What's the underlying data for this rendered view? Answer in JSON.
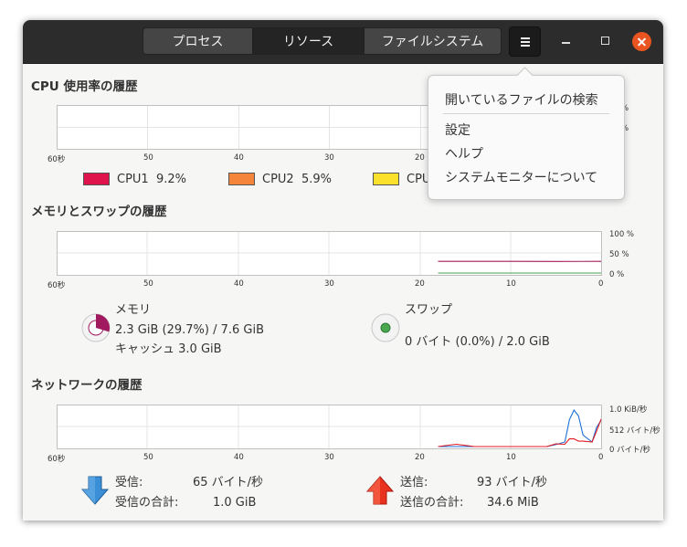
{
  "header": {
    "tabs": [
      {
        "label": "プロセス",
        "active": false
      },
      {
        "label": "リソース",
        "active": true
      },
      {
        "label": "ファイルシステム",
        "active": false
      }
    ],
    "menu_icon": "hamburger-icon",
    "minimize_glyph": "−",
    "maximize_glyph": "□",
    "close_icon": "close-icon"
  },
  "cpu": {
    "title": "CPU 使用率の履歴",
    "x_ticks": [
      "60秒",
      "50",
      "40",
      "30",
      "20"
    ],
    "y_ticks": [
      "%",
      "%"
    ],
    "legend": [
      {
        "name": "CPU1",
        "value": "9.2%",
        "color": "#e0144d"
      },
      {
        "name": "CPU2",
        "value": "5.9%",
        "color": "#f5853a"
      },
      {
        "name": "CPU",
        "value": "",
        "color": "#fbe12b"
      }
    ]
  },
  "memory": {
    "title": "メモリとスワップの履歴",
    "x_ticks": [
      "60秒",
      "50",
      "40",
      "30",
      "20",
      "10",
      "0"
    ],
    "y_ticks": [
      "100 %",
      "50 %",
      "0 %"
    ],
    "memory_label": "メモリ",
    "memory_value": "2.3 GiB (29.7%) / 7.6 GiB",
    "cache_value": "キャッシュ 3.0 GiB",
    "swap_label": "スワップ",
    "swap_value": "0 バイト (0.0%) / 2.0 GiB",
    "memory_color": "#a11a60",
    "swap_color": "#4aa64f",
    "memory_percent": 29.7,
    "swap_percent": 0.0
  },
  "network": {
    "title": "ネットワークの履歴",
    "x_ticks": [
      "60秒",
      "50",
      "40",
      "30",
      "20",
      "10",
      "0"
    ],
    "y_ticks": [
      "1.0 KiB/秒",
      "512 バイト/秒",
      "0 バイト/秒"
    ],
    "recv_label": "受信:",
    "recv_value": "65 バイト/秒",
    "recv_total_label": "受信の合計:",
    "recv_total_value": "1.0 GiB",
    "send_label": "送信:",
    "send_value": "93 バイト/秒",
    "send_total_label": "送信の合計:",
    "send_total_value": "34.6 MiB",
    "recv_color": "#1c71d8",
    "send_color": "#e01b24"
  },
  "chart_data": [
    {
      "type": "line",
      "title": "メモリとスワップの履歴",
      "x": [
        18,
        15,
        10,
        5,
        0
      ],
      "series": [
        {
          "name": "メモリ",
          "values": [
            29.7,
            29.8,
            29.7,
            29.6,
            29.7
          ]
        },
        {
          "name": "スワップ",
          "values": [
            0,
            0,
            0,
            0,
            0
          ]
        }
      ],
      "xlim": [
        60,
        0
      ],
      "ylim": [
        0,
        100
      ]
    },
    {
      "type": "line",
      "title": "ネットワークの履歴",
      "x": [
        18,
        16,
        14,
        12,
        10,
        8,
        6,
        5,
        4,
        3.5,
        3,
        2.5,
        2,
        1,
        0.5,
        0
      ],
      "series": [
        {
          "name": "受信",
          "values": [
            0,
            0,
            0,
            0,
            0,
            0,
            0,
            50,
            120,
            700,
            950,
            800,
            300,
            120,
            500,
            680
          ]
        },
        {
          "name": "送信",
          "values": [
            0,
            60,
            0,
            0,
            0,
            0,
            0,
            70,
            60,
            200,
            200,
            140,
            140,
            120,
            400,
            720
          ]
        }
      ],
      "xlim": [
        60,
        0
      ],
      "ylim": [
        0,
        1024
      ]
    }
  ],
  "popup_menu": {
    "items": [
      "開いているファイルの検索",
      "設定",
      "ヘルプ",
      "システムモニターについて"
    ]
  }
}
